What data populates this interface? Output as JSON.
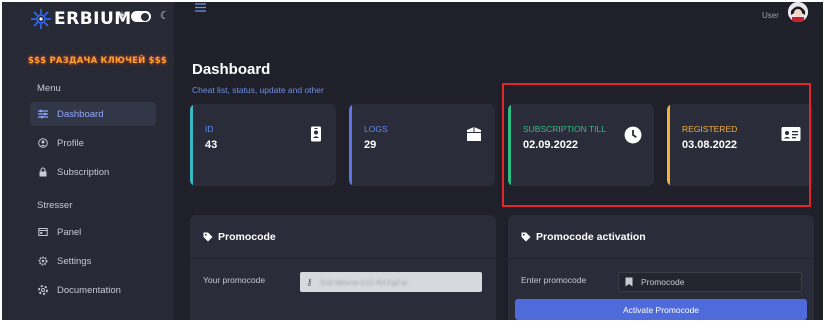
{
  "brand": {
    "logo_text": "ERBIUM",
    "accent": "#2f6bff",
    "background": "#1f2029",
    "sidebar_bg": "#272a35",
    "card_bg": "#2a2d39"
  },
  "sidebar": {
    "banner": "$$$ РАЗДАЧА КЛЮЧЕЙ $$$",
    "menu_label": "Menu",
    "menu_items": [
      {
        "label": "Dashboard",
        "icon": "sliders-icon",
        "active": true
      },
      {
        "label": "Profile",
        "icon": "user-circle-icon",
        "active": false
      },
      {
        "label": "Subscription",
        "icon": "lock-icon",
        "active": false
      }
    ],
    "stresser_label": "Stresser",
    "stresser_items": [
      {
        "label": "Panel",
        "icon": "window-icon"
      },
      {
        "label": "Settings",
        "icon": "gear-icon"
      },
      {
        "label": "Documentation",
        "icon": "lifebuoy-icon"
      }
    ]
  },
  "topbar": {
    "user_label": "User",
    "menu_icon": "hamburger-icon"
  },
  "dashboard": {
    "title": "Dashboard",
    "subtitle": "Cheat list, status, update and other"
  },
  "cards": [
    {
      "label": "ID",
      "value": "43",
      "color": "#3bb8c4",
      "icon": "id-badge-icon"
    },
    {
      "label": "LOGS",
      "value": "29",
      "color": "#5b74e8",
      "icon": "box-icon"
    },
    {
      "label": "SUBSCRIPTION TILL",
      "value": "02.09.2022",
      "color": "#2fbf83",
      "icon": "clock-icon"
    },
    {
      "label": "REGISTERED",
      "value": "03.08.2022",
      "color": "#f2b13a",
      "icon": "id-card-icon"
    }
  ],
  "promocode_panel": {
    "title": "Promocode",
    "field_label": "Your promocode",
    "value": "2c0-Wmrw-Cr2-RsYgCw"
  },
  "activation_panel": {
    "title": "Promocode activation",
    "field_label": "Enter promocode",
    "placeholder": "Promocode",
    "button_label": "Activate Promocode"
  }
}
